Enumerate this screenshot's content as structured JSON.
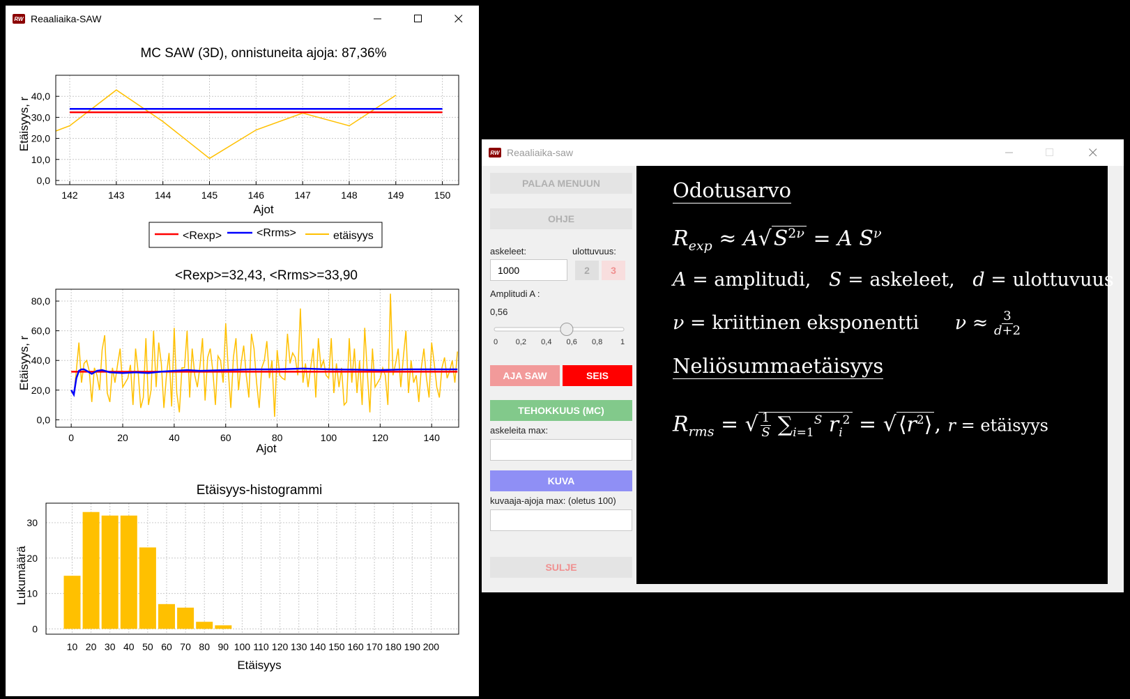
{
  "left_window": {
    "title": "Reaaliaika-SAW",
    "icon_text": "RW",
    "chart1": {
      "title": "MC SAW (3D), onnistuneita ajoja: 87,36%",
      "xlabel": "Ajot",
      "ylabel": "Etäisyys, r",
      "legend": [
        "<Rexp>",
        "<Rrms>",
        "etäisyys"
      ]
    },
    "chart2": {
      "title": "<Rexp>=32,43, <Rrms>=33,90",
      "xlabel": "Ajot",
      "ylabel": "Etäisyys, r"
    },
    "chart3": {
      "title": "Etäisyys-histogrammi",
      "xlabel": "Etäisyys",
      "ylabel": "Lukumäärä"
    }
  },
  "right_window": {
    "title": "Reaaliaika-saw",
    "icon_text": "RW",
    "palaa_label": "PALAA MENUUN",
    "ohje_label": "OHJE",
    "askeleet_label": "askeleet:",
    "ulottuvuus_label": "ulottuvuus:",
    "askeleet_value": "1000",
    "dim2_label": "2",
    "dim3_label": "3",
    "amplitudi_label": "Amplitudi A :",
    "amplitudi_value": "0,56",
    "slider_fraction": 0.56,
    "slider_ticks": [
      "0",
      "0,2",
      "0,4",
      "0,6",
      "0,8",
      "1"
    ],
    "aja_label": "AJA SAW",
    "seis_label": "SEIS",
    "tehokkuus_label": "TEHOKKUUS (MC)",
    "askeleita_max_label": "askeleita max:",
    "askeleita_max_value": "",
    "kuva_label": "KUVA",
    "kuvaaja_label": "kuvaaja-ajoja max: (oletus 100)",
    "kuvaaja_value": "",
    "sulje_label": "SULJE",
    "colors": {
      "aja": "#f29a9a",
      "seis": "#ff0000",
      "tehokkuus": "#82c98b",
      "kuva": "#8f8ff5",
      "sulje_text": "#f09090",
      "disabled_bg": "#e4e4e4"
    },
    "math": {
      "heading1": "Odotusarvo",
      "heading2": "Neliösummaetäisyys",
      "amplitudi_word": "amplitudi,",
      "askeleet_word": "askeleet,",
      "ulottuvuus_word": "ulottuvuus",
      "kriittinen_word": "kriittinen eksponentti",
      "etaisyys_word": "etäisyys"
    }
  },
  "chart_data": [
    {
      "type": "line",
      "title": "MC SAW (3D), onnistuneita ajoja: 87,36%",
      "xlabel": "Ajot",
      "ylabel": "Etäisyys, r",
      "xlim": [
        141.7,
        150.35
      ],
      "ylim": [
        -2,
        50
      ],
      "xticks": [
        142,
        143,
        144,
        145,
        146,
        147,
        148,
        149,
        150
      ],
      "xtick_labels": [
        "142",
        "143",
        "144",
        "145",
        "146",
        "147",
        "148",
        "149",
        "150"
      ],
      "yticks": [
        0,
        10,
        20,
        30,
        40
      ],
      "ytick_labels": [
        "0,0",
        "10,0",
        "20,0",
        "30,0",
        "40,0"
      ],
      "grid": true,
      "legend_position": "bottom",
      "series": [
        {
          "name": "<Rexp>",
          "color": "#ff0000",
          "x": [
            142,
            150
          ],
          "y": [
            32.4,
            32.4
          ]
        },
        {
          "name": "<Rrms>",
          "color": "#0000ff",
          "x": [
            142,
            150
          ],
          "y": [
            34.0,
            34.0
          ]
        },
        {
          "name": "etäisyys",
          "color": "#ffc000",
          "x": [
            141.7,
            142,
            143,
            144,
            145,
            146,
            147,
            148,
            149
          ],
          "y": [
            23.5,
            26,
            43,
            28,
            10.5,
            24,
            32,
            26,
            40.5
          ]
        }
      ]
    },
    {
      "type": "line",
      "title": "<Rexp>=32,43, <Rrms>=33,90",
      "xlabel": "Ajot",
      "ylabel": "Etäisyys, r",
      "xlim": [
        -6,
        150.5
      ],
      "ylim": [
        -5,
        88
      ],
      "xticks": [
        0,
        20,
        40,
        60,
        80,
        100,
        120,
        140
      ],
      "xtick_labels": [
        "0",
        "20",
        "40",
        "60",
        "80",
        "100",
        "120",
        "140"
      ],
      "yticks": [
        0,
        20,
        40,
        60,
        80
      ],
      "ytick_labels": [
        "0,0",
        "20,0",
        "40,0",
        "60,0",
        "80,0"
      ],
      "grid": true,
      "series": [
        {
          "name": "<Rexp>",
          "color": "#ff0000",
          "x": [
            0,
            150
          ],
          "y": [
            32.4,
            32.4
          ]
        },
        {
          "name": "<Rrms>",
          "color": "#0000ff",
          "x": [
            0,
            1,
            2,
            3,
            4,
            5,
            6,
            8,
            10,
            12,
            15,
            20,
            25,
            30,
            35,
            40,
            45,
            50,
            60,
            70,
            80,
            90,
            100,
            110,
            120,
            130,
            140,
            150
          ],
          "y": [
            20,
            17,
            28,
            33,
            34,
            34,
            33,
            31,
            33,
            33.5,
            32,
            31.5,
            32,
            31.5,
            32.5,
            33,
            33.5,
            33,
            33.5,
            34,
            34,
            34.5,
            34,
            33.8,
            33.5,
            34,
            34,
            34
          ]
        },
        {
          "name": "etäisyys",
          "color": "#ffc000",
          "x": [
            0,
            1,
            2,
            3,
            4,
            5,
            6,
            7,
            8,
            9,
            10,
            11,
            12,
            13,
            14,
            15,
            16,
            17,
            18,
            19,
            20,
            21,
            22,
            23,
            24,
            25,
            26,
            27,
            28,
            29,
            30,
            31,
            32,
            33,
            34,
            35,
            36,
            37,
            38,
            39,
            40,
            41,
            42,
            43,
            44,
            45,
            46,
            47,
            48,
            49,
            50,
            51,
            52,
            53,
            54,
            55,
            56,
            57,
            58,
            59,
            60,
            61,
            62,
            63,
            64,
            65,
            66,
            67,
            68,
            69,
            70,
            71,
            72,
            73,
            74,
            75,
            76,
            77,
            78,
            79,
            80,
            81,
            82,
            83,
            84,
            85,
            86,
            87,
            88,
            89,
            90,
            91,
            92,
            93,
            94,
            95,
            96,
            97,
            98,
            99,
            100,
            101,
            102,
            103,
            104,
            105,
            106,
            107,
            108,
            109,
            110,
            111,
            112,
            113,
            114,
            115,
            116,
            117,
            118,
            119,
            120,
            121,
            122,
            123,
            124,
            125,
            126,
            127,
            128,
            129,
            130,
            131,
            132,
            133,
            134,
            135,
            136,
            137,
            138,
            139,
            140,
            141,
            142,
            143,
            144,
            145,
            146,
            147,
            148,
            149,
            150
          ],
          "y": [
            19,
            17,
            33,
            52,
            25,
            38,
            40,
            33,
            12,
            35,
            30,
            20,
            47,
            57,
            18,
            12,
            35,
            25,
            37,
            48,
            22,
            25,
            28,
            37,
            10,
            48,
            32,
            8,
            15,
            55,
            10,
            20,
            60,
            22,
            52,
            38,
            8,
            30,
            45,
            9,
            62,
            18,
            5,
            35,
            35,
            60,
            15,
            48,
            30,
            22,
            36,
            55,
            13,
            42,
            48,
            33,
            10,
            43,
            40,
            25,
            65,
            33,
            8,
            42,
            55,
            20,
            38,
            50,
            30,
            15,
            58,
            48,
            25,
            8,
            35,
            40,
            53,
            28,
            40,
            2,
            47,
            30,
            28,
            27,
            58,
            38,
            45,
            42,
            30,
            75,
            25,
            38,
            22,
            35,
            48,
            15,
            55,
            35,
            40,
            30,
            28,
            55,
            18,
            38,
            22,
            35,
            10,
            12,
            55,
            25,
            48,
            18,
            40,
            10,
            62,
            32,
            5,
            48,
            22,
            25,
            28,
            35,
            30,
            10,
            85,
            30,
            38,
            48,
            22,
            42,
            60,
            18,
            40,
            25,
            30,
            12,
            35,
            48,
            28,
            15,
            52,
            38,
            22,
            15,
            35,
            42,
            28,
            33,
            40,
            25,
            46
          ]
        }
      ]
    },
    {
      "type": "bar",
      "title": "Etäisyys-histogrammi",
      "xlabel": "Etäisyys",
      "ylabel": "Lukumäärä",
      "color": "#ffc000",
      "categories": [
        "10",
        "20",
        "30",
        "40",
        "50",
        "60",
        "70",
        "80",
        "90",
        "100",
        "110",
        "120",
        "130",
        "140",
        "150",
        "160",
        "170",
        "180",
        "190",
        "200"
      ],
      "values": [
        15,
        33,
        32,
        32,
        23,
        7,
        6,
        2,
        1,
        0,
        0,
        0,
        0,
        0,
        0,
        0,
        0,
        0,
        0,
        0
      ],
      "ylim": [
        -1.5,
        35.5
      ],
      "yticks": [
        0,
        10,
        20,
        30
      ],
      "ytick_labels": [
        "0",
        "10",
        "20",
        "30"
      ],
      "grid": true
    }
  ]
}
